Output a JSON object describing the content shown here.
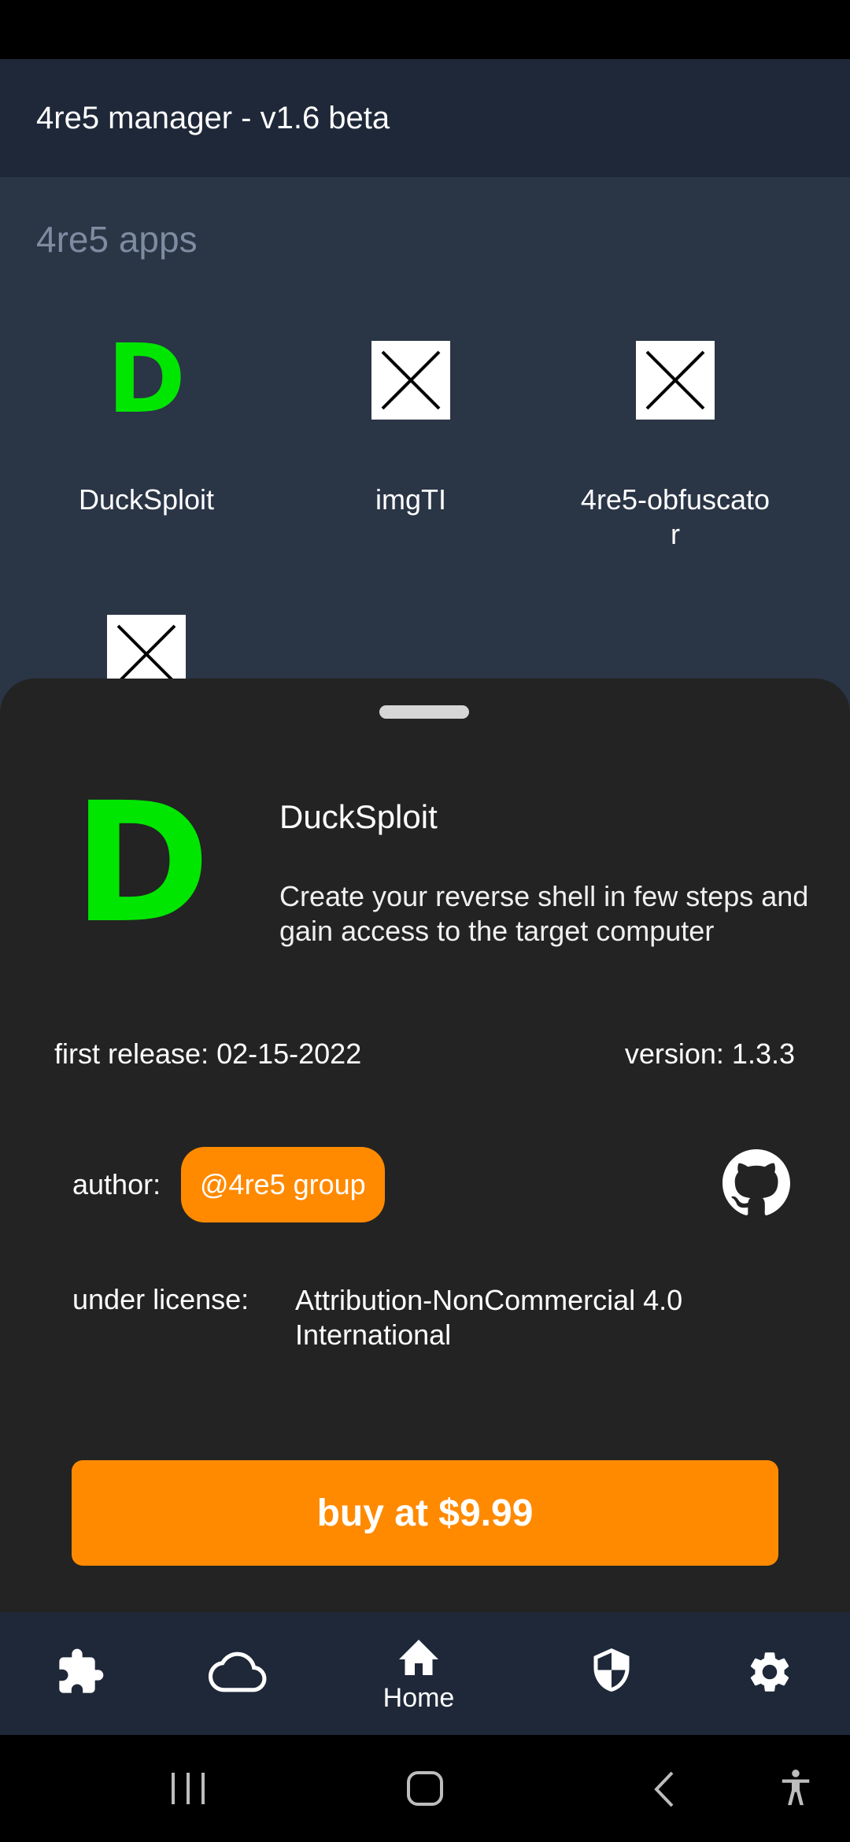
{
  "app_bar": {
    "title": "4re5 manager - v1.6 beta"
  },
  "apps_section": {
    "title": "4re5 apps",
    "apps": [
      {
        "name": "DuckSploit",
        "icon": "d-logo-icon"
      },
      {
        "name": "imgTI",
        "icon": "broken-image-icon"
      },
      {
        "name": "4re5-obfuscator",
        "icon": "broken-image-icon"
      },
      {
        "name": "",
        "icon": "broken-image-icon"
      }
    ]
  },
  "sheet": {
    "title": "DuckSploit",
    "description": "Create your reverse shell in few steps and gain access to the target computer",
    "first_release": "first release: 02-15-2022",
    "version": "version: 1.3.3",
    "author_label": "author:",
    "author": "@4re5 group",
    "license_label": "under license:",
    "license": "Attribution-NonCommercial 4.0 International",
    "buy_label": "buy at $9.99"
  },
  "bottom_nav": {
    "items": [
      {
        "icon": "puzzle-icon",
        "label": ""
      },
      {
        "icon": "cloud-icon",
        "label": ""
      },
      {
        "icon": "home-icon",
        "label": "Home"
      },
      {
        "icon": "shield-icon",
        "label": ""
      },
      {
        "icon": "gear-icon",
        "label": ""
      }
    ]
  },
  "colors": {
    "accent": "#ff8a00",
    "logo_green": "#00e600",
    "app_bar": "#1e2838",
    "background": "#2a3546",
    "sheet": "#232323"
  }
}
